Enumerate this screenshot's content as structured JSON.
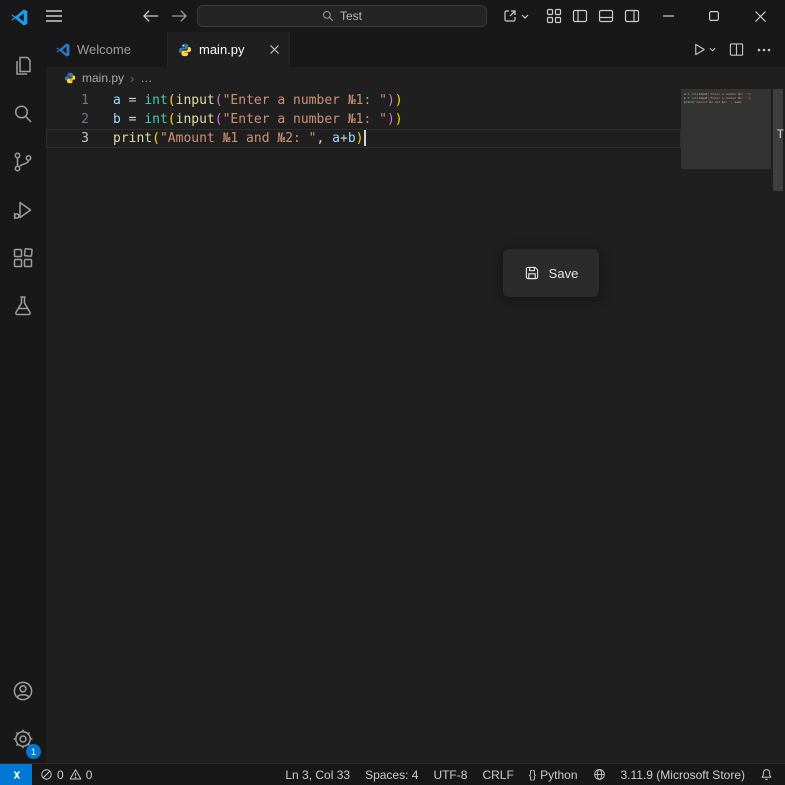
{
  "titlebar": {
    "search_label": "Test"
  },
  "tabs": {
    "welcome_label": "Welcome",
    "file_label": "main.py"
  },
  "breadcrumb": {
    "file": "main.py",
    "separator": "›",
    "more": "…"
  },
  "editor": {
    "lines": [
      {
        "number": "1",
        "tokens": [
          {
            "t": "a",
            "c": "v"
          },
          {
            "t": " = ",
            "c": "d"
          },
          {
            "t": "int",
            "c": "cl"
          },
          {
            "t": "(",
            "c": "p1"
          },
          {
            "t": "input",
            "c": "fn"
          },
          {
            "t": "(",
            "c": "p2"
          },
          {
            "t": "\"Enter a number №1: \"",
            "c": "s"
          },
          {
            "t": ")",
            "c": "p2"
          },
          {
            "t": ")",
            "c": "p1"
          }
        ]
      },
      {
        "number": "2",
        "tokens": [
          {
            "t": "b",
            "c": "v"
          },
          {
            "t": " = ",
            "c": "d"
          },
          {
            "t": "int",
            "c": "cl"
          },
          {
            "t": "(",
            "c": "p1"
          },
          {
            "t": "input",
            "c": "fn"
          },
          {
            "t": "(",
            "c": "p2"
          },
          {
            "t": "\"Enter a number №1: \"",
            "c": "s"
          },
          {
            "t": ")",
            "c": "p2"
          },
          {
            "t": ")",
            "c": "p1"
          }
        ]
      },
      {
        "number": "3",
        "current": true,
        "cursor": true,
        "tokens": [
          {
            "t": "print",
            "c": "fn"
          },
          {
            "t": "(",
            "c": "p1"
          },
          {
            "t": "\"Amount №1 and №2: \"",
            "c": "s"
          },
          {
            "t": ", ",
            "c": "d"
          },
          {
            "t": "a",
            "c": "v"
          },
          {
            "t": "+",
            "c": "d"
          },
          {
            "t": "b",
            "c": "v"
          },
          {
            "t": ")",
            "c": "p1"
          }
        ]
      }
    ]
  },
  "overlay": {
    "save_label": "Save"
  },
  "overview_marker": "T",
  "activity_badge": "1",
  "statusbar": {
    "errors": "0",
    "warnings": "0",
    "line_col": "Ln 3, Col 33",
    "spaces": "Spaces: 4",
    "encoding": "UTF-8",
    "eol": "CRLF",
    "lang_icon": "{}",
    "language": "Python",
    "interpreter": "3.11.9 (Microsoft Store)"
  },
  "colors": {
    "accent": "#0078d4"
  }
}
